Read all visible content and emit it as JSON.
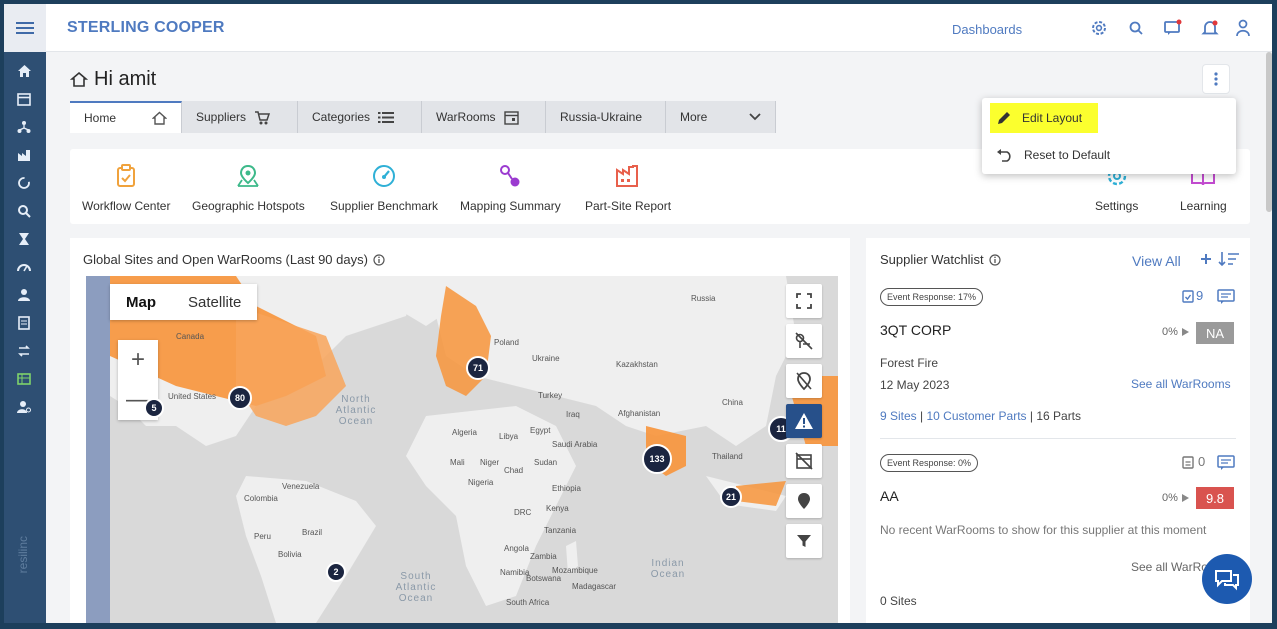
{
  "brand": "STERLING COOPER",
  "header": {
    "dashboards": "Dashboards"
  },
  "greeting": "Hi amit",
  "tabs": [
    {
      "label": "Home",
      "icon": "home-icon"
    },
    {
      "label": "Suppliers",
      "icon": "supplier-icon"
    },
    {
      "label": "Categories",
      "icon": "list-icon"
    },
    {
      "label": "WarRooms",
      "icon": "calendar-icon"
    },
    {
      "label": "Russia-Ukraine",
      "icon": ""
    },
    {
      "label": "More",
      "icon": "chevron-down-icon"
    }
  ],
  "quick_links": [
    {
      "label": "Workflow Center",
      "color": "#f0a23c"
    },
    {
      "label": "Geographic Hotspots",
      "color": "#3db98a"
    },
    {
      "label": "Supplier Benchmark",
      "color": "#2fb0d6"
    },
    {
      "label": "Mapping Summary",
      "color": "#9b3bd0"
    },
    {
      "label": "Part-Site Report",
      "color": "#e8604c"
    },
    {
      "label": "Settings",
      "color": "#2fb0d6"
    },
    {
      "label": "Learning",
      "color": "#c34bd0"
    }
  ],
  "dropdown": {
    "edit": "Edit Layout",
    "reset": "Reset to Default"
  },
  "map_panel": {
    "title": "Global Sites and Open WarRooms (Last 90 days)",
    "map_type": {
      "map": "Map",
      "satellite": "Satellite"
    },
    "zoom_in": "+",
    "zoom_out": "—",
    "clusters": [
      "80",
      "71",
      "133",
      "21",
      "11",
      "2",
      "5"
    ],
    "labels": [
      "Russia",
      "Poland",
      "Ukraine",
      "Kazakhstan",
      "Turkey",
      "Iraq",
      "Afghanistan",
      "China",
      "Algeria",
      "Libya",
      "Egypt",
      "Saudi Arabia",
      "Mali",
      "Niger",
      "Chad",
      "Sudan",
      "Nigeria",
      "Ethiopia",
      "DRC",
      "Kenya",
      "Tanzania",
      "Angola",
      "Zambia",
      "Botswana",
      "Namibia",
      "South Africa",
      "Mozambique",
      "Madagascar",
      "Thailand",
      "Venezuela",
      "Colombia",
      "Peru",
      "Brazil",
      "Bolivia",
      "United States",
      "Canada"
    ],
    "oceans": {
      "north_atlantic": "North Atlantic Ocean",
      "south_atlantic": "South Atlantic Ocean",
      "indian": "Indian Ocean"
    }
  },
  "watchlist": {
    "title": "Supplier Watchlist",
    "view_all": "View All",
    "items": [
      {
        "event_response": "Event Response: 17%",
        "count": "9",
        "company": "3QT CORP",
        "pct": "0%",
        "score": "NA",
        "score_color": "#9a9a9a",
        "event": "Forest Fire",
        "date": "12 May 2023",
        "see_all": "See all WarRooms",
        "sites": "9 Sites",
        "customer_parts": "10 Customer Parts",
        "parts": "16 Parts"
      },
      {
        "event_response": "Event Response: 0%",
        "count": "0",
        "company": "AA",
        "pct": "0%",
        "score": "9.8",
        "score_color": "#d9534f",
        "message": "No recent WarRooms to show for this supplier at this moment",
        "see_all": "See all WarRooms",
        "sites": "0 Sites"
      }
    ]
  },
  "rail_brand": "resilinc"
}
